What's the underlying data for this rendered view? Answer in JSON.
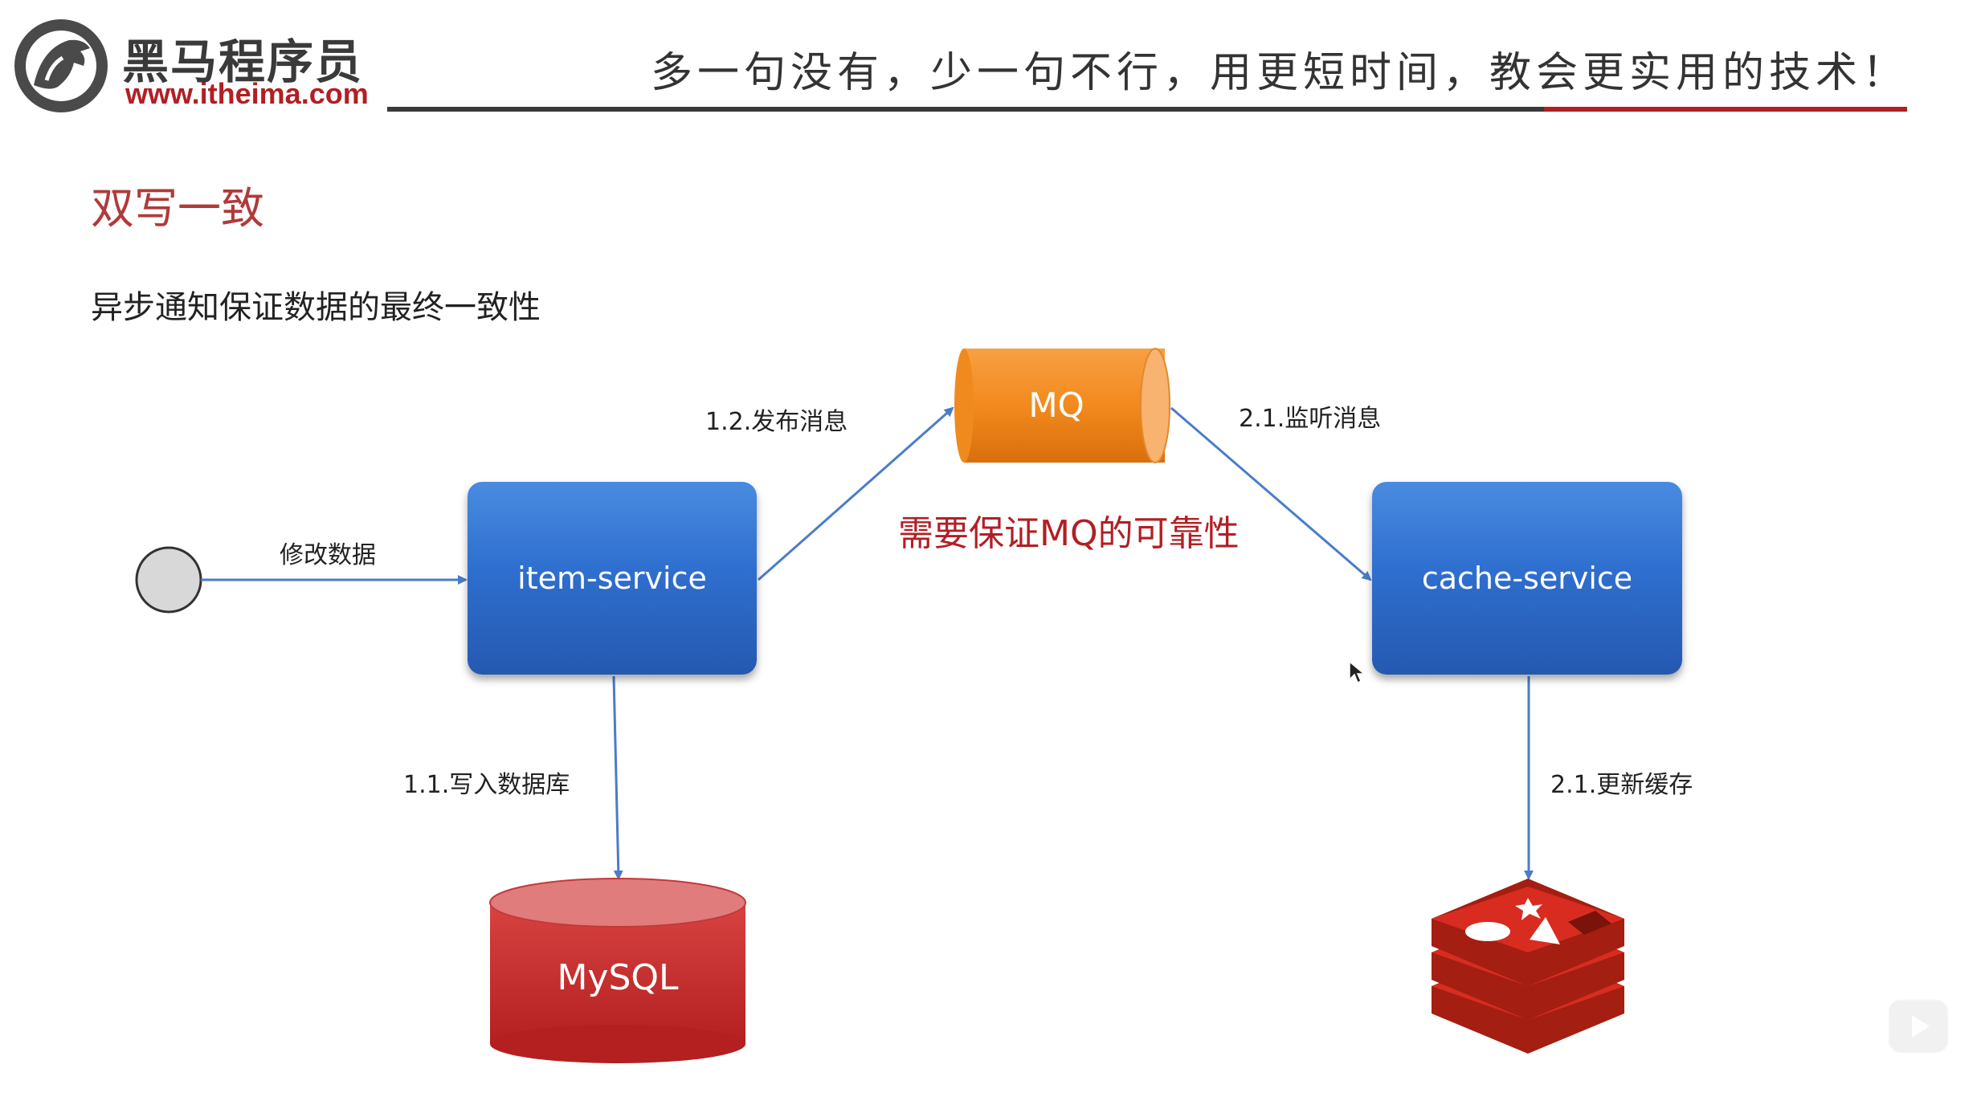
{
  "header": {
    "brand_name": "黑马程序员",
    "brand_url": "www.itheima.com",
    "slogan": "多一句没有，少一句不行，用更短时间，教会更实用的技术！"
  },
  "slide": {
    "title": "双写一致",
    "subtitle": "异步通知保证数据的最终一致性"
  },
  "diagram": {
    "nodes": {
      "item_service": "item-service",
      "cache_service": "cache-service",
      "mq": "MQ",
      "mysql": "MySQL"
    },
    "edges": {
      "modify_data": "修改数据",
      "publish": "1.2.发布消息",
      "listen": "2.1.监听消息",
      "write_db": "1.1.写入数据库",
      "update_cache": "2.1.更新缓存"
    },
    "note": "需要保证MQ的可靠性"
  },
  "colors": {
    "brand_red": "#b11f24",
    "service_blue": "#2f6fcf",
    "mq_orange": "#f28a1e",
    "mysql_red": "#c8302f",
    "redis_red": "#d82c20",
    "arrow_blue": "#4a7cc9"
  }
}
